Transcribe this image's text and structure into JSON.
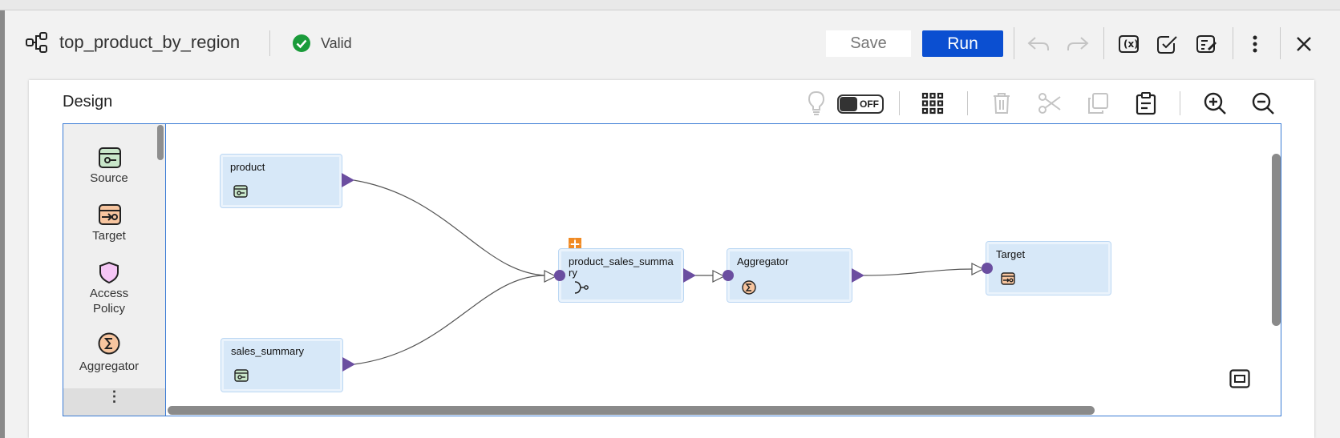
{
  "header": {
    "title": "top_product_by_region",
    "status": "Valid",
    "save_label": "Save",
    "run_label": "Run"
  },
  "design": {
    "title": "Design",
    "recommendation_toggle": "OFF"
  },
  "palette": {
    "items": [
      {
        "label": "Source",
        "icon": "source-icon"
      },
      {
        "label": "Target",
        "icon": "target-icon"
      },
      {
        "label": "Access\nPolicy",
        "icon": "access-policy-icon"
      },
      {
        "label": "Aggregator",
        "icon": "aggregator-icon"
      }
    ],
    "more": "⋮"
  },
  "nodes": {
    "product": {
      "label": "product",
      "type": "source"
    },
    "sales_summary": {
      "label": "sales_summary",
      "type": "source"
    },
    "joiner": {
      "label": "product_sales_summa\nry",
      "type": "joiner"
    },
    "aggregator": {
      "label": "Aggregator",
      "type": "aggregator"
    },
    "target": {
      "label": "Target",
      "type": "target"
    }
  },
  "colors": {
    "accent": "#0b4fd1",
    "valid": "#1a9b3a",
    "node_fill": "#d7e8f8",
    "port": "#6b4ea0",
    "canvas_border": "#3a7bd5"
  }
}
